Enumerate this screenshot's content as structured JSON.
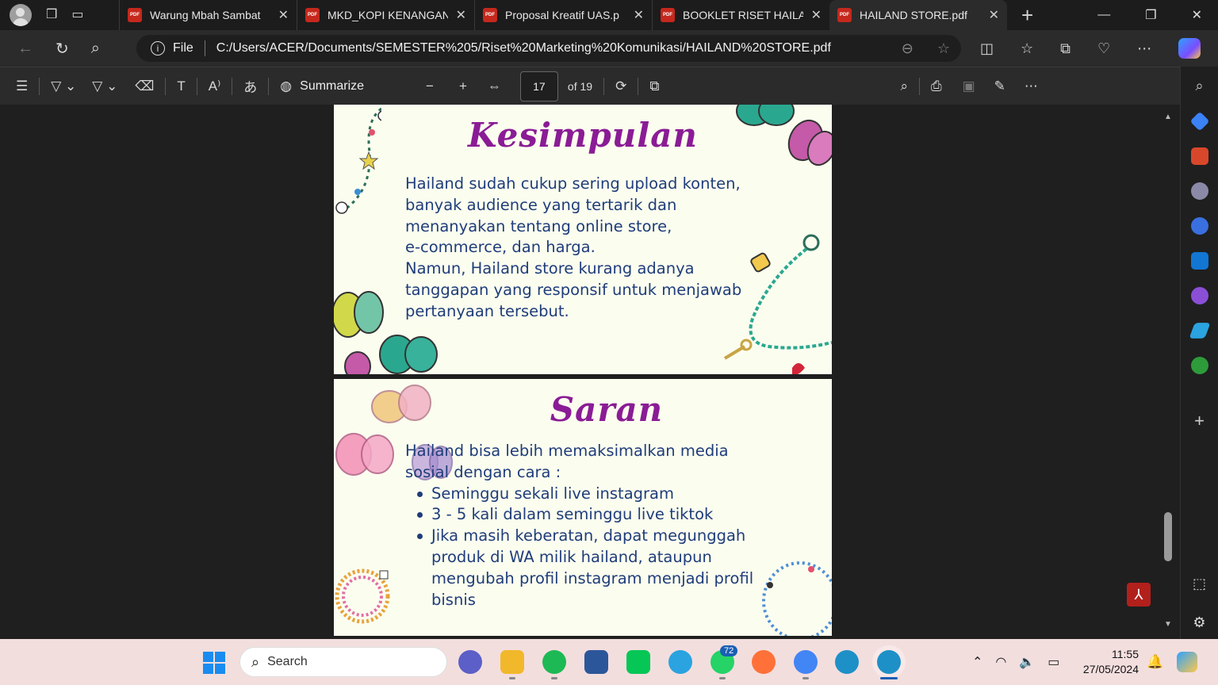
{
  "browser": {
    "tabs": [
      {
        "label": "Warung Mbah Sambat",
        "icon": "pdf-icon",
        "active": false
      },
      {
        "label": "MKD_KOPI KENANGAN",
        "icon": "pdf-icon",
        "active": false
      },
      {
        "label": "Proposal Kreatif UAS.p",
        "icon": "pdf-icon",
        "active": false
      },
      {
        "label": "BOOKLET RISET HAILA",
        "icon": "pdf-icon",
        "active": false
      },
      {
        "label": "HAILAND STORE.pdf",
        "icon": "pdf-icon",
        "active": true
      }
    ],
    "pdf_badge": "PDF",
    "address": {
      "scheme_label": "File",
      "url": "C:/Users/ACER/Documents/SEMESTER%205/Riset%20Marketing%20Komunikasi/HAILAND%20STORE.pdf"
    }
  },
  "pdf_toolbar": {
    "summarize_label": "Summarize",
    "current_page": "17",
    "page_total": "of 19"
  },
  "document": {
    "page1": {
      "heading": "Kesimpulan",
      "lines": [
        "Hailand sudah cukup sering upload konten,",
        "banyak audience yang tertarik dan",
        "menanyakan tentang online store,",
        "e-commerce, dan harga.",
        "Namun, Hailand store kurang adanya",
        "tanggapan yang responsif untuk menjawab",
        "pertanyaan tersebut."
      ]
    },
    "page2": {
      "heading": "Saran",
      "intro": [
        "Hailand bisa lebih memaksimalkan media",
        "sosial dengan cara :"
      ],
      "bullets": [
        [
          "Seminggu sekali live instagram"
        ],
        [
          "3 - 5 kali dalam seminggu live tiktok"
        ],
        [
          "Jika masih keberatan, dapat megunggah",
          "produk di WA milik hailand, ataupun",
          "mengubah profil instagram menjadi profil",
          "bisnis"
        ]
      ]
    }
  },
  "taskbar": {
    "search_placeholder": "Search",
    "whatsapp_badge": "72",
    "time": "11:55",
    "date": "27/05/2024"
  },
  "colors": {
    "heading": "#8a1c95",
    "body_text": "#1f3d7a",
    "page_bg": "#fbfdef",
    "pdf_red": "#c5281c"
  }
}
